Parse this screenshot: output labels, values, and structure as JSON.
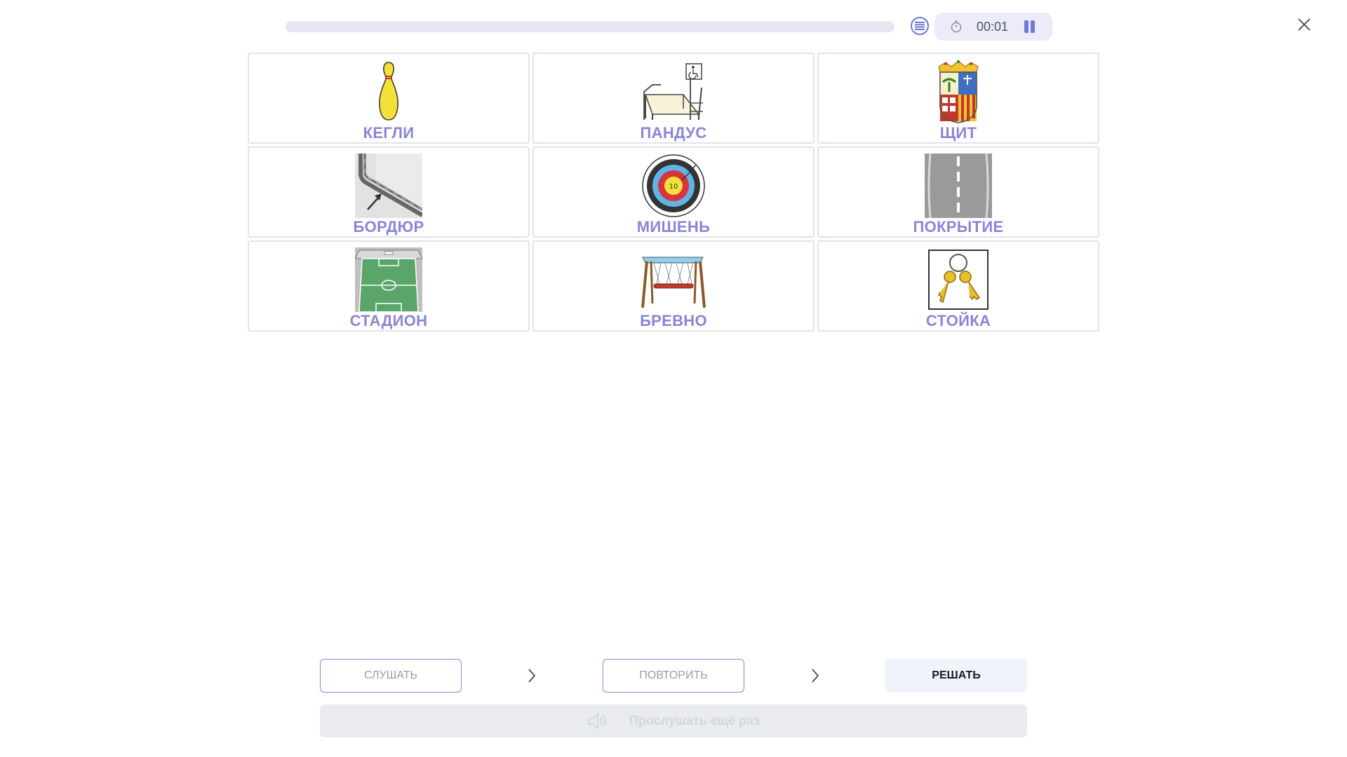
{
  "timer": {
    "time": "00:01"
  },
  "progress": {
    "fraction": 0.0
  },
  "cards": [
    {
      "label": "КЕГЛИ",
      "icon": "bowling-pin-icon"
    },
    {
      "label": "ПАНДУС",
      "icon": "ramp-icon"
    },
    {
      "label": "ЩИТ",
      "icon": "coat-of-arms-shield-icon"
    },
    {
      "label": "БОРДЮР",
      "icon": "curb-icon"
    },
    {
      "label": "МИШЕНЬ",
      "icon": "archery-target-icon"
    },
    {
      "label": "ПОКРЫТИЕ",
      "icon": "road-surface-icon"
    },
    {
      "label": "СТАДИОН",
      "icon": "stadium-icon"
    },
    {
      "label": "БРЕВНО",
      "icon": "log-swing-icon"
    },
    {
      "label": "СТОЙКА",
      "icon": "keys-icon"
    }
  ],
  "steps": {
    "listen_label": "СЛУШАТЬ",
    "repeat_label": "ПОВТОРИТЬ",
    "solve_label": "РЕШАТЬ"
  },
  "replay": {
    "label": "Прослушать ещё раз"
  },
  "colors": {
    "accent": "#8a85d6",
    "card_border": "#e2e2ef",
    "timer_bg": "#ecebf7"
  }
}
